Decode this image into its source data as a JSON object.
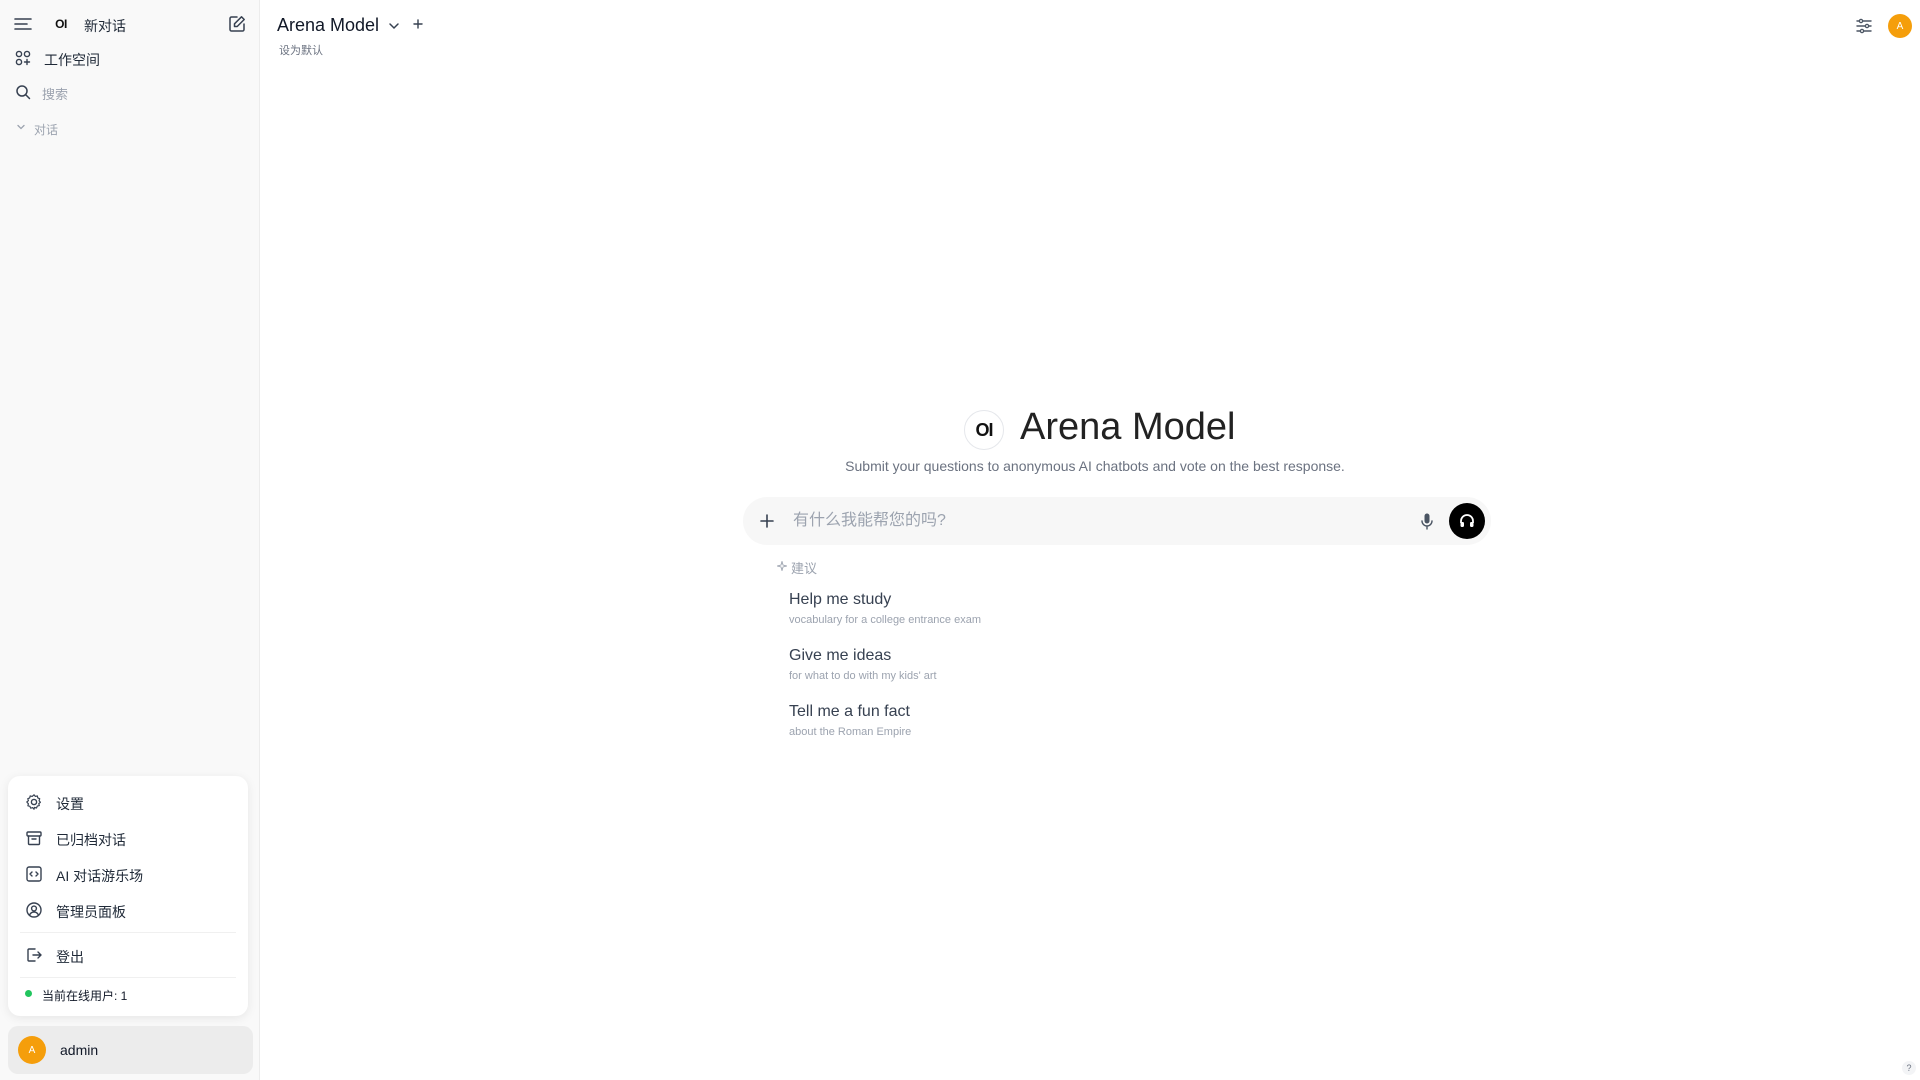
{
  "sidebar": {
    "logo_text": "OI",
    "new_chat_label": "新对话",
    "workspace_label": "工作空间",
    "search_placeholder": "搜索",
    "chats_section_label": "对话",
    "menu": {
      "settings_label": "设置",
      "archived_label": "已归档对话",
      "playground_label": "AI 对话游乐场",
      "admin_panel_label": "管理员面板",
      "logout_label": "登出",
      "online_users_label": "当前在线用户: 1"
    },
    "user": {
      "avatar_letter": "A",
      "name": "admin"
    }
  },
  "header": {
    "model_name": "Arena Model",
    "set_default_label": "设为默认",
    "avatar_letter": "A"
  },
  "hero": {
    "logo_text": "OI",
    "title": "Arena Model",
    "subtitle": "Submit your questions to anonymous AI chatbots and vote on the best response."
  },
  "composer": {
    "placeholder": "有什么我能帮您的吗?"
  },
  "suggestions": {
    "label": "建议",
    "items": [
      {
        "title": "Help me study",
        "desc": "vocabulary for a college entrance exam"
      },
      {
        "title": "Give me ideas",
        "desc": "for what to do with my kids' art"
      },
      {
        "title": "Tell me a fun fact",
        "desc": "about the Roman Empire"
      }
    ]
  },
  "help_label": "?",
  "colors": {
    "avatar": "#f59e0b",
    "online": "#22c55e",
    "sidebar_bg": "#f9f9f9"
  }
}
